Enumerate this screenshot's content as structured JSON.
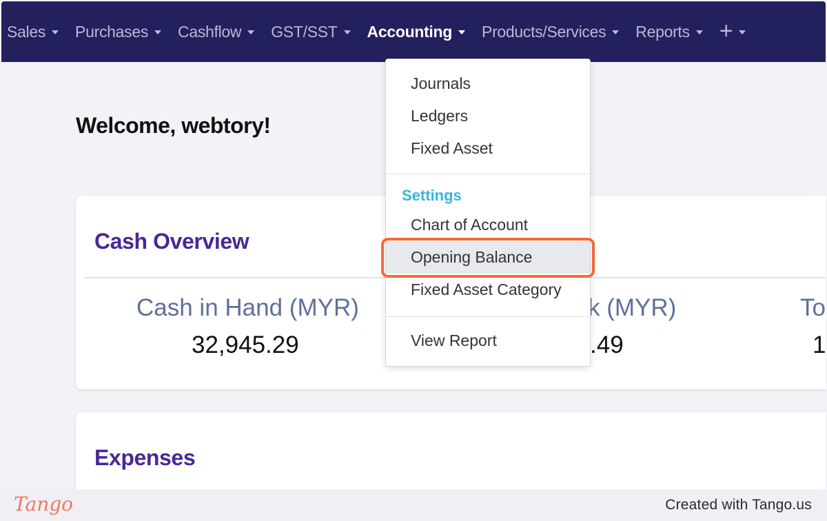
{
  "nav": {
    "items": [
      {
        "label": "Sales",
        "active": false
      },
      {
        "label": "Purchases",
        "active": false
      },
      {
        "label": "Cashflow",
        "active": false
      },
      {
        "label": "GST/SST",
        "active": false
      },
      {
        "label": "Accounting",
        "active": true
      },
      {
        "label": "Products/Services",
        "active": false
      },
      {
        "label": "Reports",
        "active": false
      }
    ],
    "plus_label": "+"
  },
  "welcome": "Welcome, webtory!",
  "cash_overview": {
    "title": "Cash Overview",
    "stats": [
      {
        "label": "Cash in Hand (MYR)",
        "value": "32,945.29"
      },
      {
        "label": "k (MYR)",
        "value": ".49"
      },
      {
        "label": "To",
        "value": "1"
      }
    ]
  },
  "expenses": {
    "title": "Expenses"
  },
  "dropdown": {
    "items": [
      "Journals",
      "Ledgers",
      "Fixed Asset"
    ],
    "settings_header": "Settings",
    "settings_items": [
      "Chart of Account",
      "Opening Balance",
      "Fixed Asset Category"
    ],
    "report_item": "View Report",
    "highlighted": "Opening Balance"
  },
  "footer": {
    "logo": "Tango",
    "credit": "Created with Tango.us"
  },
  "colors": {
    "nav_bg": "#23205e",
    "title_purple": "#4a2796",
    "settings_blue": "#37b5e0",
    "focus_orange": "#f26b3a"
  }
}
